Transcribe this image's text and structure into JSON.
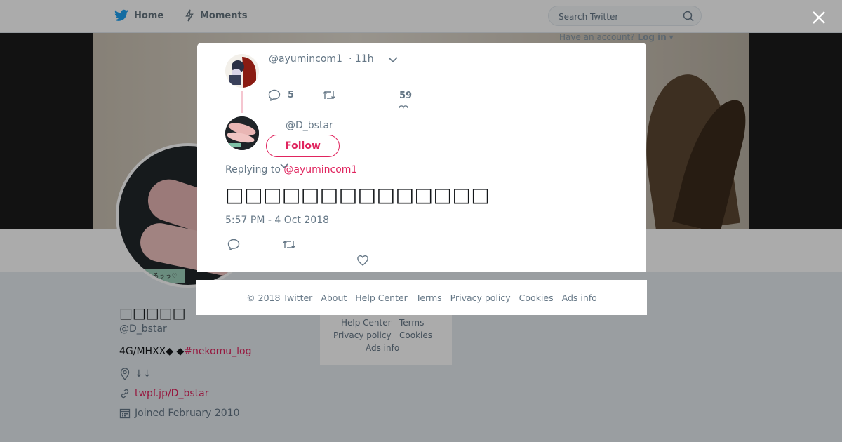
{
  "topbar": {
    "home_label": "Home",
    "moments_label": "Moments",
    "search_placeholder": "Search Twitter",
    "account_prompt": "Have an account?",
    "login_label": "Log in",
    "brand_color": "#1da1f2"
  },
  "profile": {
    "name": "□□□□□",
    "handle": "@D_bstar",
    "bio_text": "4G/MHXX◆ ◆",
    "bio_hashtag": "#nekomu_log",
    "location": "↓↓",
    "url": "twpf.jp/D_bstar",
    "joined": "Joined February 2010",
    "avatar_tag": "るぅぅ♡"
  },
  "sidebar_footer": {
    "row1": [
      "Help Center",
      "Terms"
    ],
    "row2": [
      "Privacy policy",
      "Cookies"
    ],
    "row3": [
      "Ads info"
    ]
  },
  "modal": {
    "parent": {
      "handle": "@ayumincom1",
      "time": "· 11h",
      "reply_count": "5",
      "like_count": "59"
    },
    "main": {
      "handle": "@D_bstar",
      "follow_label": "Follow",
      "replying_prefix": "Replying to",
      "replying_to": "@ayumincom1",
      "text": "□□□□□□□□□□□□□□",
      "timestamp": "5:57 PM - 4 Oct 2018"
    },
    "accent_color": "#e0245e"
  },
  "footer": {
    "copyright": "© 2018 Twitter",
    "links": [
      "About",
      "Help Center",
      "Terms",
      "Privacy policy",
      "Cookies",
      "Ads info"
    ]
  }
}
